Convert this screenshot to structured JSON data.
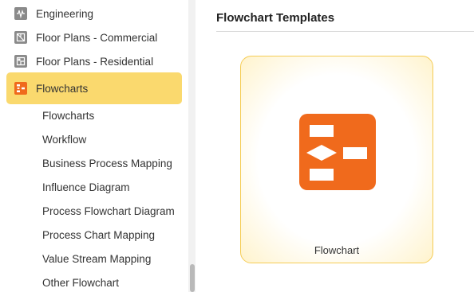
{
  "sidebar": {
    "categories": [
      {
        "label": "Engineering",
        "icon": "engineering-icon"
      },
      {
        "label": "Floor Plans - Commercial",
        "icon": "floor-plan-commercial-icon"
      },
      {
        "label": "Floor Plans - Residential",
        "icon": "floor-plan-residential-icon"
      },
      {
        "label": "Flowcharts",
        "icon": "flowchart-icon",
        "active": true
      }
    ],
    "subitems": [
      "Flowcharts",
      "Workflow",
      "Business Process Mapping",
      "Influence Diagram",
      "Process Flowchart Diagram",
      "Process Chart Mapping",
      "Value Stream Mapping",
      "Other Flowchart"
    ]
  },
  "main": {
    "section_title": "Flowchart Templates",
    "templates": [
      {
        "label": "Flowchart",
        "icon": "flowchart-template-icon"
      }
    ]
  },
  "colors": {
    "active_bg": "#fad96e",
    "accent_orange": "#f06a1c",
    "card_border": "#f5cc55"
  }
}
